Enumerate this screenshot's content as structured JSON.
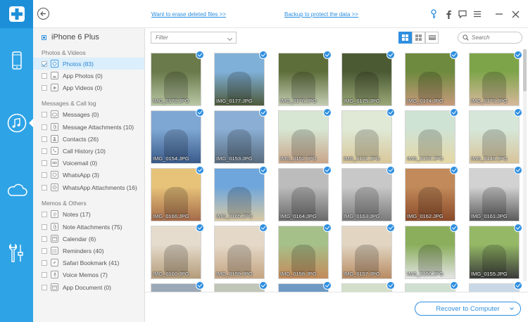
{
  "colors": {
    "rail": "#2ea3e6",
    "accent": "#2f8fe0",
    "link": "#2a8fe0"
  },
  "topbar": {
    "link_erase": "Want to erase deleted files >>",
    "link_backup": "Backup to protect the data >>",
    "icons": [
      "back-icon",
      "key-icon",
      "facebook-icon",
      "feedback-icon",
      "menu-icon",
      "minimize-icon",
      "close-icon"
    ]
  },
  "rail": {
    "items": [
      {
        "icon": "phone-icon"
      },
      {
        "icon": "music-icon"
      },
      {
        "icon": "cloud-icon"
      },
      {
        "icon": "tools-icon"
      }
    ]
  },
  "sidebar": {
    "device": "iPhone 6 Plus",
    "sections": [
      {
        "title": "Photos & Videos"
      },
      {
        "title": "Messages & Call log"
      },
      {
        "title": "Memos & Others"
      }
    ],
    "items": [
      {
        "label": "Photos (83)"
      },
      {
        "label": "App Photos (0)"
      },
      {
        "label": "App Videos (0)"
      },
      {
        "label": "Messages (0)"
      },
      {
        "label": "Message Attachments (10)"
      },
      {
        "label": "Contacts (26)"
      },
      {
        "label": "Call History (10)"
      },
      {
        "label": "Voicemail (0)"
      },
      {
        "label": "WhatsApp (3)"
      },
      {
        "label": "WhatsApp Attachments (16)"
      },
      {
        "label": "Notes (17)"
      },
      {
        "label": "Note Attachments (75)"
      },
      {
        "label": "Calendar (6)"
      },
      {
        "label": "Reminders (40)"
      },
      {
        "label": "Safari Bookmark (41)"
      },
      {
        "label": "Voice Memos (7)"
      },
      {
        "label": "App Document (0)"
      }
    ]
  },
  "toolbar": {
    "filter_placeholder": "Filter",
    "search_placeholder": "Search"
  },
  "photos": [
    {
      "name": "IMG_0178.JPG",
      "c1": "#6a7a4a",
      "c2": "#b9c7a6"
    },
    {
      "name": "IMG_0177.JPG",
      "c1": "#7fb0d8",
      "c2": "#4e5a3a"
    },
    {
      "name": "IMG_0176.JPG",
      "c1": "#5e6e3a",
      "c2": "#c4cdb4"
    },
    {
      "name": "IMG_0175.JPG",
      "c1": "#4c5a34",
      "c2": "#9aa878"
    },
    {
      "name": "IMG_0174.JPG",
      "c1": "#6e8a3e",
      "c2": "#c79a7c"
    },
    {
      "name": "IMG_0173.JPG",
      "c1": "#7ea44a",
      "c2": "#d7b89c"
    },
    {
      "name": "IMG_0154.JPG",
      "c1": "#7fa7d4",
      "c2": "#3a5a8a"
    },
    {
      "name": "IMG_0153.JPG",
      "c1": "#8aaed4",
      "c2": "#5a6c7e"
    },
    {
      "name": "IMG_0152.JPG",
      "c1": "#d7e6d2",
      "c2": "#c9a68a"
    },
    {
      "name": "IMG_0151.JPG",
      "c1": "#dfe9d6",
      "c2": "#d9c79a"
    },
    {
      "name": "IMG_0150.JPG",
      "c1": "#cfe3d4",
      "c2": "#e6d8a6"
    },
    {
      "name": "IMG_0149.JPG",
      "c1": "#d6e7d9",
      "c2": "#d8c49a"
    },
    {
      "name": "IMG_0166.JPG",
      "c1": "#e7c37a",
      "c2": "#a46a4a"
    },
    {
      "name": "IMG_0165.JPG",
      "c1": "#6fa6dc",
      "c2": "#d9c9a4"
    },
    {
      "name": "IMG_0164.JPG",
      "c1": "#bcbcbc",
      "c2": "#6a6a6a"
    },
    {
      "name": "IMG_0163.JPG",
      "c1": "#c8c8c8",
      "c2": "#7a7a7a"
    },
    {
      "name": "IMG_0162.JPG",
      "c1": "#c28a5a",
      "c2": "#8a4a2a"
    },
    {
      "name": "IMG_0161.JPG",
      "c1": "#d2d2d2",
      "c2": "#5a5a5a"
    },
    {
      "name": "IMG_0160.JPG",
      "c1": "#e6dccd",
      "c2": "#b49c7a"
    },
    {
      "name": "IMG_0159.JPG",
      "c1": "#e4d9c8",
      "c2": "#c4a482"
    },
    {
      "name": "IMG_0158.JPG",
      "c1": "#a6c08a",
      "c2": "#c48a5a"
    },
    {
      "name": "IMG_0157.JPG",
      "c1": "#e2d6c3",
      "c2": "#b88c64"
    },
    {
      "name": "IMG_0156.JPG",
      "c1": "#8aae5c",
      "c2": "#e4e4e4"
    },
    {
      "name": "IMG_0155.JPG",
      "c1": "#94b866",
      "c2": "#3a3a3a"
    },
    {
      "name": "",
      "c1": "#9aa8b8",
      "c2": "#d0d8e0"
    },
    {
      "name": "",
      "c1": "#c0c6b8",
      "c2": "#e0e4dc"
    },
    {
      "name": "",
      "c1": "#6e9ac4",
      "c2": "#c4d4e0"
    },
    {
      "name": "",
      "c1": "#d4dfca",
      "c2": "#e6ece0"
    },
    {
      "name": "",
      "c1": "#cfe0d0",
      "c2": "#e4ece2"
    },
    {
      "name": "",
      "c1": "#c8d8e6",
      "c2": "#e0e8ee"
    }
  ],
  "bottom": {
    "recover_label": "Recover to Computer"
  }
}
